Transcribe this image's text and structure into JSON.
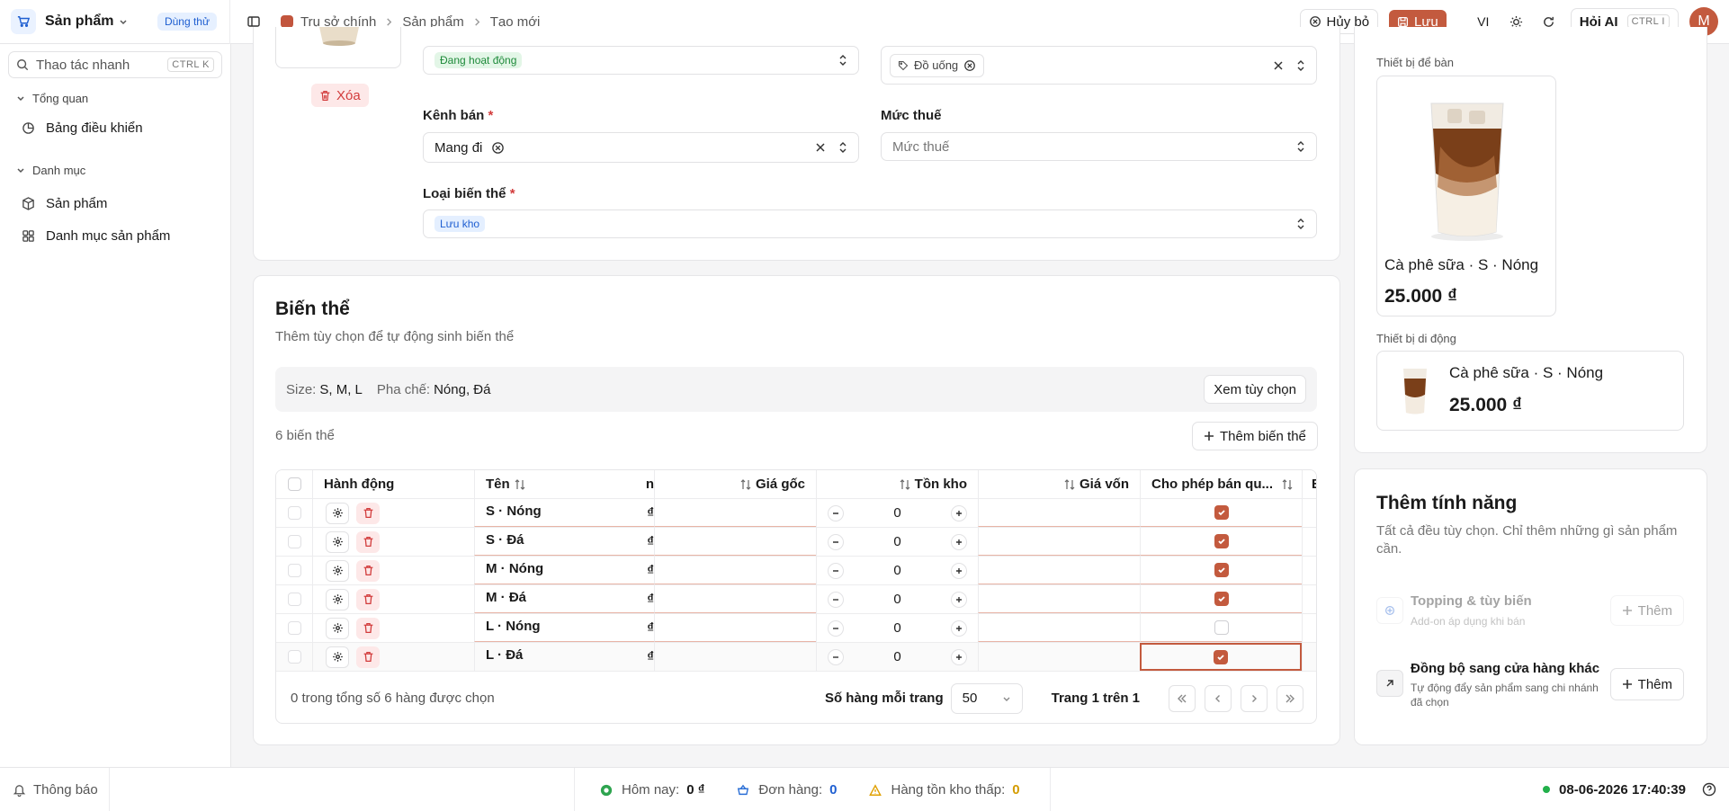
{
  "topbar": {
    "app_name": "Sản phẩm",
    "trial_label": "Dùng thử",
    "breadcrumbs": [
      "Trụ sở chính",
      "Sản phẩm",
      "Tạo mới"
    ],
    "cancel_label": "Hủy bỏ",
    "save_label": "Lưu",
    "language": "VI",
    "ai_label": "Hỏi AI",
    "ai_shortcut": "CTRL I",
    "avatar_initial": "M"
  },
  "sidebar": {
    "quick_action_placeholder": "Thao tác nhanh",
    "quick_action_shortcut": "CTRL K",
    "groups": [
      {
        "label": "Tổng quan",
        "items": [
          "Bảng điều khiển"
        ]
      },
      {
        "label": "Danh mục",
        "items": [
          "Sản phẩm",
          "Danh mục sản phẩm"
        ]
      }
    ]
  },
  "form": {
    "delete_label": "Xóa",
    "status_chip": "Đang hoạt động",
    "tag_chip": "Đồ uống",
    "channel_label": "Kênh bán",
    "channel_value": "Mang đi",
    "tax_label": "Mức thuế",
    "tax_placeholder": "Mức thuế",
    "variant_type_label": "Loại biến thể",
    "variant_type_value": "Lưu kho"
  },
  "variants": {
    "title": "Biến thể",
    "subtitle": "Thêm tùy chọn để tự động sinh biến thể",
    "option_size_label": "Size:",
    "option_size_value": "S, M, L",
    "option_brew_label": "Pha chế:",
    "option_brew_value": "Nóng, Đá",
    "view_options_label": "Xem tùy chọn",
    "count_label": "6 biến thể",
    "add_variant_label": "Thêm biến thể",
    "columns": {
      "actions": "Hành động",
      "name": "Tên",
      "hidden_partial": "n",
      "base_price": "Giá gốc",
      "stock": "Tồn kho",
      "cost": "Giá vốn",
      "allow_sell": "Cho phép bán qu...",
      "next_partial": "E"
    },
    "currency_symbol": "₫",
    "rows": [
      {
        "name": "S · Nóng",
        "stock": "0",
        "allow": true
      },
      {
        "name": "S · Đá",
        "stock": "0",
        "allow": true
      },
      {
        "name": "M · Nóng",
        "stock": "0",
        "allow": true
      },
      {
        "name": "M · Đá",
        "stock": "0",
        "allow": true
      },
      {
        "name": "L · Nóng",
        "stock": "0",
        "allow": false
      },
      {
        "name": "L · Đá",
        "stock": "0",
        "allow": true
      }
    ],
    "selection_summary": "0 trong tổng số 6 hàng được chọn",
    "rows_per_page_label": "Số hàng mỗi trang",
    "rows_per_page_value": "50",
    "page_label": "Trang 1 trên 1"
  },
  "preview": {
    "desktop_label": "Thiết bị để bàn",
    "mobile_label": "Thiết bị di động",
    "product_name": "Cà phê sữa · S · Nóng",
    "product_price": "25.000 ₫"
  },
  "features": {
    "title": "Thêm tính năng",
    "subtitle": "Tất cả đều tùy chọn. Chỉ thêm những gì sản phẩm cần.",
    "items": [
      {
        "title": "Topping & tùy biến",
        "desc": "Add-on áp dụng khi bán",
        "button": "Thêm",
        "enabled": false
      },
      {
        "title": "Đồng bộ sang cửa hàng khác",
        "desc": "Tự động đẩy sản phẩm sang chi nhánh đã chọn",
        "button": "Thêm",
        "enabled": true
      }
    ]
  },
  "footer": {
    "notifications_label": "Thông báo",
    "today_label": "Hôm nay:",
    "today_value": "0 ₫",
    "orders_label": "Đơn hàng:",
    "orders_value": "0",
    "low_stock_label": "Hàng tồn kho thấp:",
    "low_stock_value": "0",
    "datetime": "08-06-2026 17:40:39"
  },
  "colors": {
    "accent": "#c35a3e",
    "success": "#1e8a3a",
    "info": "#1f5fd1",
    "danger": "#d23c3c"
  }
}
